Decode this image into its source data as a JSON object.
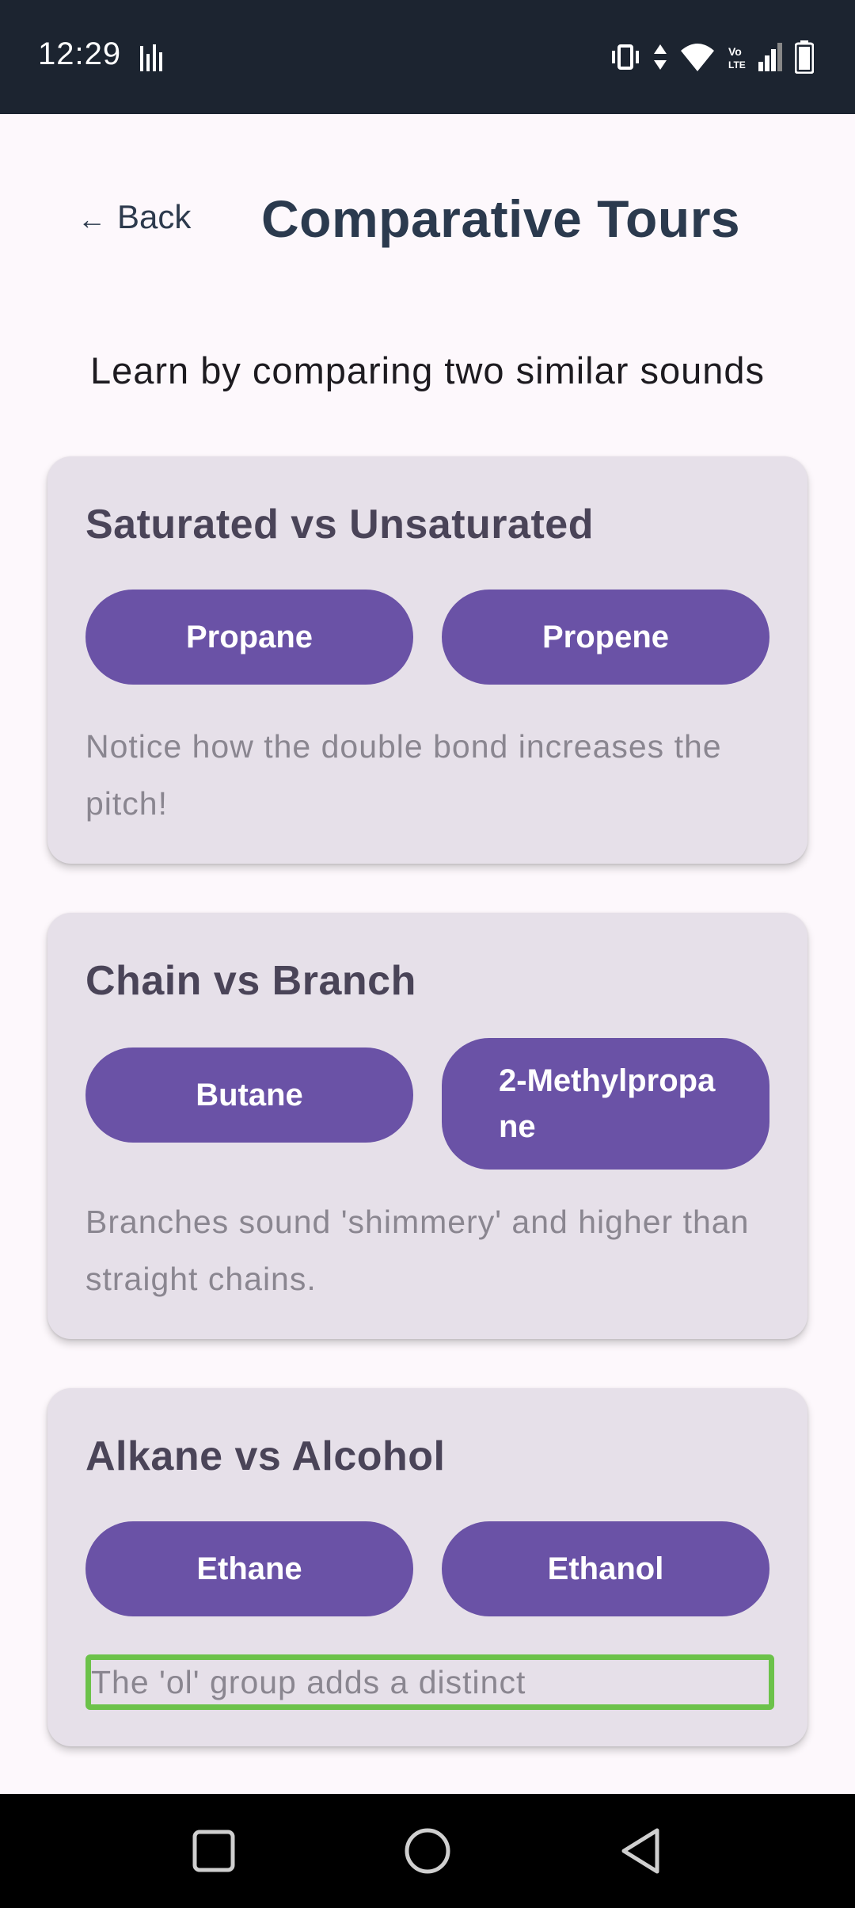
{
  "status_bar": {
    "time": "12:29"
  },
  "header": {
    "back_label": "Back",
    "back_arrow": "←",
    "title": "Comparative Tours"
  },
  "subtitle": "Learn by comparing two similar sounds",
  "cards": [
    {
      "title": "Saturated vs Unsaturated",
      "left_button": "Propane",
      "right_button": "Propene",
      "note": "Notice how the double bond increases the pitch!"
    },
    {
      "title": "Chain vs Branch",
      "left_button": "Butane",
      "right_button": "2-Methylpropane",
      "note": "Branches sound 'shimmery' and higher than straight chains."
    },
    {
      "title": "Alkane vs Alcohol",
      "left_button": "Ethane",
      "right_button": "Ethanol",
      "note": "The 'ol' group adds a distinct"
    }
  ],
  "colors": {
    "accent": "#6a52a6",
    "card_background": "#e6e0e9",
    "status_bar": "#1c2430",
    "highlight": "#6cc24a"
  },
  "icons": {
    "status_left": "sound-bars-icon",
    "status_right": [
      "vibrate-icon",
      "data-arrows-icon",
      "wifi-icon",
      "volte-icon",
      "signal-icon",
      "battery-icon"
    ],
    "nav": [
      "recents-square-icon",
      "home-circle-icon",
      "back-triangle-icon"
    ]
  }
}
